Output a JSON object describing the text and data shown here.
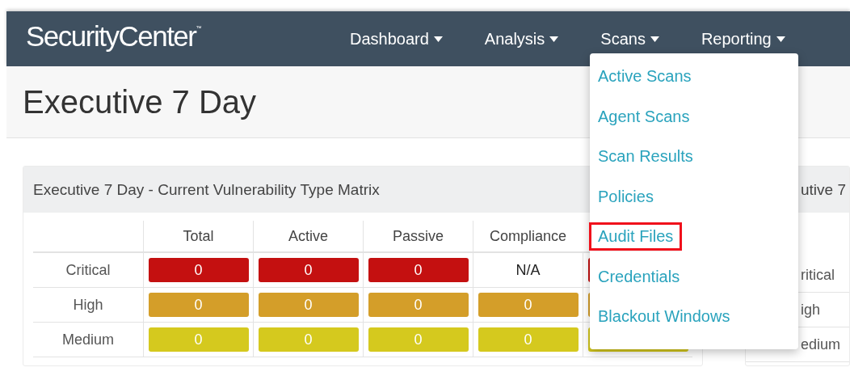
{
  "header": {
    "logo": "SecurityCenter",
    "logo_mark": "™",
    "nav": [
      "Dashboard",
      "Analysis",
      "Scans",
      "Reporting"
    ]
  },
  "page_title": "Executive 7 Day",
  "matrix_panel": {
    "title": "Executive 7 Day - Current Vulnerability Type Matrix",
    "columns": [
      "Total",
      "Active",
      "Passive",
      "Compliance"
    ],
    "rows": [
      {
        "label": "Critical",
        "color": "#c41010",
        "cells": [
          {
            "kind": "bar",
            "value": "0"
          },
          {
            "kind": "bar",
            "value": "0"
          },
          {
            "kind": "bar",
            "value": "0"
          },
          {
            "kind": "text",
            "value": "N/A"
          }
        ]
      },
      {
        "label": "High",
        "color": "#d49e29",
        "cells": [
          {
            "kind": "bar",
            "value": "0"
          },
          {
            "kind": "bar",
            "value": "0"
          },
          {
            "kind": "bar",
            "value": "0"
          },
          {
            "kind": "bar",
            "value": "0"
          }
        ]
      },
      {
        "label": "Medium",
        "color": "#d5c91e",
        "cells": [
          {
            "kind": "bar",
            "value": "0"
          },
          {
            "kind": "bar",
            "value": "0"
          },
          {
            "kind": "bar",
            "value": "0"
          },
          {
            "kind": "bar",
            "value": "0"
          }
        ]
      }
    ]
  },
  "side_panel": {
    "title": "utive 7",
    "rows": [
      "ritical",
      "igh",
      "edium"
    ]
  },
  "scans_menu": [
    {
      "label": "Active Scans",
      "selected": false
    },
    {
      "label": "Agent Scans",
      "selected": false
    },
    {
      "label": "Scan Results",
      "selected": false
    },
    {
      "label": "Policies",
      "selected": false
    },
    {
      "label": "Audit Files",
      "selected": true
    },
    {
      "label": "Credentials",
      "selected": false
    },
    {
      "label": "Blackout Windows",
      "selected": false
    }
  ]
}
